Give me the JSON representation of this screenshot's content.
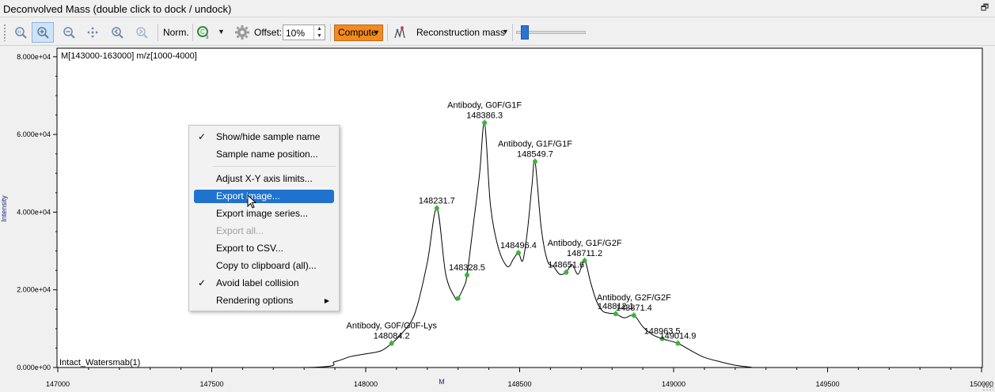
{
  "window": {
    "title": "Deconvolved Mass (double click to dock / undock)",
    "dock_glyph": "🗗"
  },
  "toolbar": {
    "norm_label": "Norm.",
    "offset_label": "Offset:",
    "offset_value": "10%",
    "compute_label": "Compute",
    "reconstruction_label": "Reconstruction mass"
  },
  "plot": {
    "header_label": "M[143000-163000] m/z[1000-4000]",
    "sample_name": "Intact_Watersmab(1)",
    "x_axis_label": "M",
    "y_axis_label": "Intensity",
    "y_ticks": [
      "0.000e+00",
      "2.000e+04",
      "4.000e+04",
      "6.000e+04",
      "8.000e+04"
    ],
    "x_ticks": [
      "147000",
      "147500",
      "148000",
      "148500",
      "149000",
      "149500",
      "150000"
    ]
  },
  "context_menu": {
    "items": [
      {
        "label": "Show/hide sample name",
        "checked": "✓"
      },
      {
        "label": "Sample name position..."
      },
      {
        "label": "Adjust X-Y axis limits..."
      },
      {
        "label": "Export image..."
      },
      {
        "label": "Export image series..."
      },
      {
        "label": "Export all..."
      },
      {
        "label": "Export to CSV..."
      },
      {
        "label": "Copy to clipboard (all)..."
      },
      {
        "label": "Avoid label collision",
        "checked": "✓"
      },
      {
        "label": "Rendering options"
      }
    ]
  },
  "chart_data": {
    "type": "line",
    "title": "",
    "xlabel": "M",
    "ylabel": "Intensity",
    "xlim": [
      147000,
      150000
    ],
    "ylim": [
      0,
      82000
    ],
    "series": [
      {
        "x": [
          147000,
          147800,
          147900,
          147950,
          148000,
          148050,
          148084,
          148120,
          148160,
          148200,
          148231,
          148260,
          148290,
          148300,
          148320,
          148329,
          148350,
          148370,
          148386,
          148405,
          148430,
          148460,
          148480,
          148496,
          148510,
          148525,
          148540,
          148550,
          148570,
          148590,
          148610,
          148630,
          148651,
          148670,
          148690,
          148711,
          148730,
          148750,
          148770,
          148790,
          148812,
          148840,
          148871,
          148900,
          148930,
          148963,
          149014,
          149060,
          149100,
          149150,
          149200,
          149250,
          149300,
          150000
        ],
        "y": [
          0,
          0,
          1500,
          2800,
          3500,
          4300,
          6200,
          9000,
          14000,
          27000,
          41000,
          24000,
          18000,
          17800,
          21000,
          23800,
          37000,
          50000,
          63000,
          42000,
          31000,
          26000,
          28000,
          29500,
          27500,
          35000,
          47000,
          53000,
          36000,
          27500,
          26000,
          24000,
          24500,
          26500,
          24000,
          27500,
          22000,
          17000,
          14500,
          14000,
          13800,
          12800,
          13400,
          10500,
          8500,
          7400,
          6200,
          4200,
          2600,
          1500,
          600,
          100,
          0,
          0
        ]
      }
    ],
    "markers_x": [
      148084,
      148231,
      148300,
      148329,
      148386,
      148496,
      148550,
      148651,
      148711,
      148812,
      148871,
      148963,
      149014
    ],
    "annotations": [
      {
        "x": 148084,
        "y": 6200,
        "lines": [
          "Antibody, G0F/G0F-Lys",
          "148084.2"
        ]
      },
      {
        "x": 148231,
        "y": 41000,
        "lines": [
          "148231.7"
        ]
      },
      {
        "x": 148329,
        "y": 23800,
        "lines": [
          "148328.5"
        ]
      },
      {
        "x": 148386,
        "y": 63000,
        "lines": [
          "Antibody, G0F/G1F",
          "148386.3"
        ]
      },
      {
        "x": 148496,
        "y": 29500,
        "lines": [
          "148496.4"
        ]
      },
      {
        "x": 148550,
        "y": 53000,
        "lines": [
          "Antibody, G1F/G1F",
          "148549.7"
        ]
      },
      {
        "x": 148651,
        "y": 24500,
        "lines": [
          "148651.6"
        ]
      },
      {
        "x": 148711,
        "y": 27500,
        "lines": [
          "Antibody, G1F/G2F",
          "148711.2"
        ]
      },
      {
        "x": 148812,
        "y": 13800,
        "lines": [
          "148812.1"
        ]
      },
      {
        "x": 148871,
        "y": 13400,
        "lines": [
          "Antibody, G2F/G2F",
          "148871.4"
        ]
      },
      {
        "x": 148963,
        "y": 7400,
        "lines": [
          "148963.5"
        ]
      },
      {
        "x": 149014,
        "y": 6200,
        "lines": [
          "149014.9"
        ]
      }
    ],
    "line_color": "#000000",
    "marker_color": "#3cb43c"
  }
}
